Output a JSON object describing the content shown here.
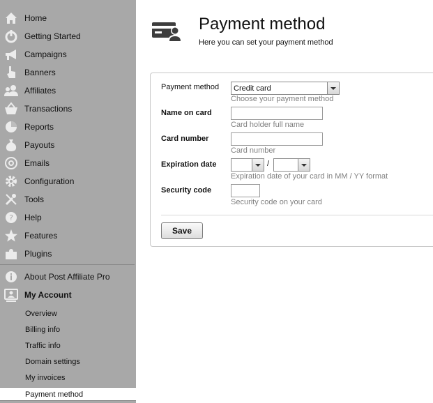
{
  "sidebar": {
    "items": [
      {
        "label": "Home",
        "icon": "home-icon"
      },
      {
        "label": "Getting Started",
        "icon": "power-icon"
      },
      {
        "label": "Campaigns",
        "icon": "megaphone-icon"
      },
      {
        "label": "Banners",
        "icon": "pointer-hand-icon"
      },
      {
        "label": "Affiliates",
        "icon": "users-icon"
      },
      {
        "label": "Transactions",
        "icon": "basket-icon"
      },
      {
        "label": "Reports",
        "icon": "pie-chart-icon"
      },
      {
        "label": "Payouts",
        "icon": "money-bag-icon"
      },
      {
        "label": "Emails",
        "icon": "at-sign-icon"
      },
      {
        "label": "Configuration",
        "icon": "gear-icon"
      },
      {
        "label": "Tools",
        "icon": "wrench-icon"
      },
      {
        "label": "Help",
        "icon": "help-icon"
      },
      {
        "label": "Features",
        "icon": "star-icon"
      },
      {
        "label": "Plugins",
        "icon": "puzzle-icon"
      }
    ],
    "about": {
      "label": "About Post Affiliate Pro",
      "icon": "info-icon"
    },
    "my_account": {
      "label": "My Account",
      "icon": "account-icon"
    },
    "sub_items": [
      {
        "label": "Overview"
      },
      {
        "label": "Billing info"
      },
      {
        "label": "Traffic info"
      },
      {
        "label": "Domain settings"
      },
      {
        "label": "My invoices"
      },
      {
        "label": "Payment method",
        "active": true
      }
    ]
  },
  "header": {
    "title": "Payment method",
    "subtitle": "Here you can set your payment method"
  },
  "form": {
    "payment_method": {
      "label": "Payment method",
      "value": "Credit card",
      "help": "Choose your payment method"
    },
    "name_on_card": {
      "label": "Name on card",
      "value": "",
      "help": "Card holder full name"
    },
    "card_number": {
      "label": "Card number",
      "value": "",
      "help": "Card number"
    },
    "expiration": {
      "label": "Expiration date",
      "month": "",
      "year": "",
      "separator": "/",
      "help": "Expiration date of your card in MM / YY format"
    },
    "security_code": {
      "label": "Security code",
      "value": "",
      "help": "Security code on your card"
    },
    "save_label": "Save"
  },
  "colors": {
    "sidebar_bg": "#a8a8a8",
    "icon_color": "#ededed",
    "help_text": "#808080"
  }
}
